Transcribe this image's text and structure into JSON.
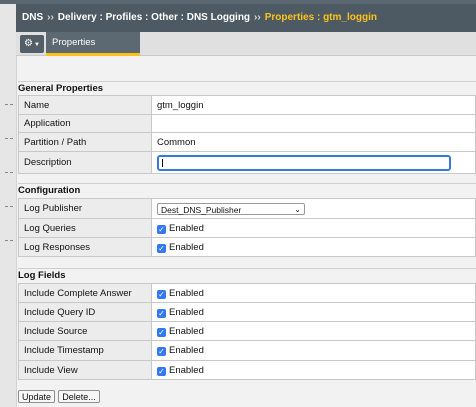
{
  "breadcrumb": {
    "items": [
      "DNS",
      "Delivery : Profiles : Other : DNS Logging",
      "Properties : gtm_loggin"
    ],
    "separator": "››"
  },
  "tabs": {
    "gear_icon": "gear-icon",
    "active": "Properties"
  },
  "general": {
    "title": "General Properties",
    "name_label": "Name",
    "name_value": "gtm_loggin",
    "application_label": "Application",
    "application_value": "",
    "partition_label": "Partition / Path",
    "partition_value": "Common",
    "description_label": "Description",
    "description_value": ""
  },
  "configuration": {
    "title": "Configuration",
    "log_publisher_label": "Log Publisher",
    "log_publisher_value": "Dest_DNS_Publisher",
    "log_queries_label": "Log Queries",
    "log_queries_value": "Enabled",
    "log_responses_label": "Log Responses",
    "log_responses_value": "Enabled"
  },
  "log_fields": {
    "title": "Log Fields",
    "rows": [
      {
        "label": "Include Complete Answer",
        "value": "Enabled"
      },
      {
        "label": "Include Query ID",
        "value": "Enabled"
      },
      {
        "label": "Include Source",
        "value": "Enabled"
      },
      {
        "label": "Include Timestamp",
        "value": "Enabled"
      },
      {
        "label": "Include View",
        "value": "Enabled"
      }
    ]
  },
  "buttons": {
    "update": "Update",
    "delete": "Delete..."
  },
  "colors": {
    "header_bg": "#4d5a63",
    "accent": "#ffc21a",
    "checkbox": "#3478f6",
    "focus": "#3a7ad6"
  }
}
